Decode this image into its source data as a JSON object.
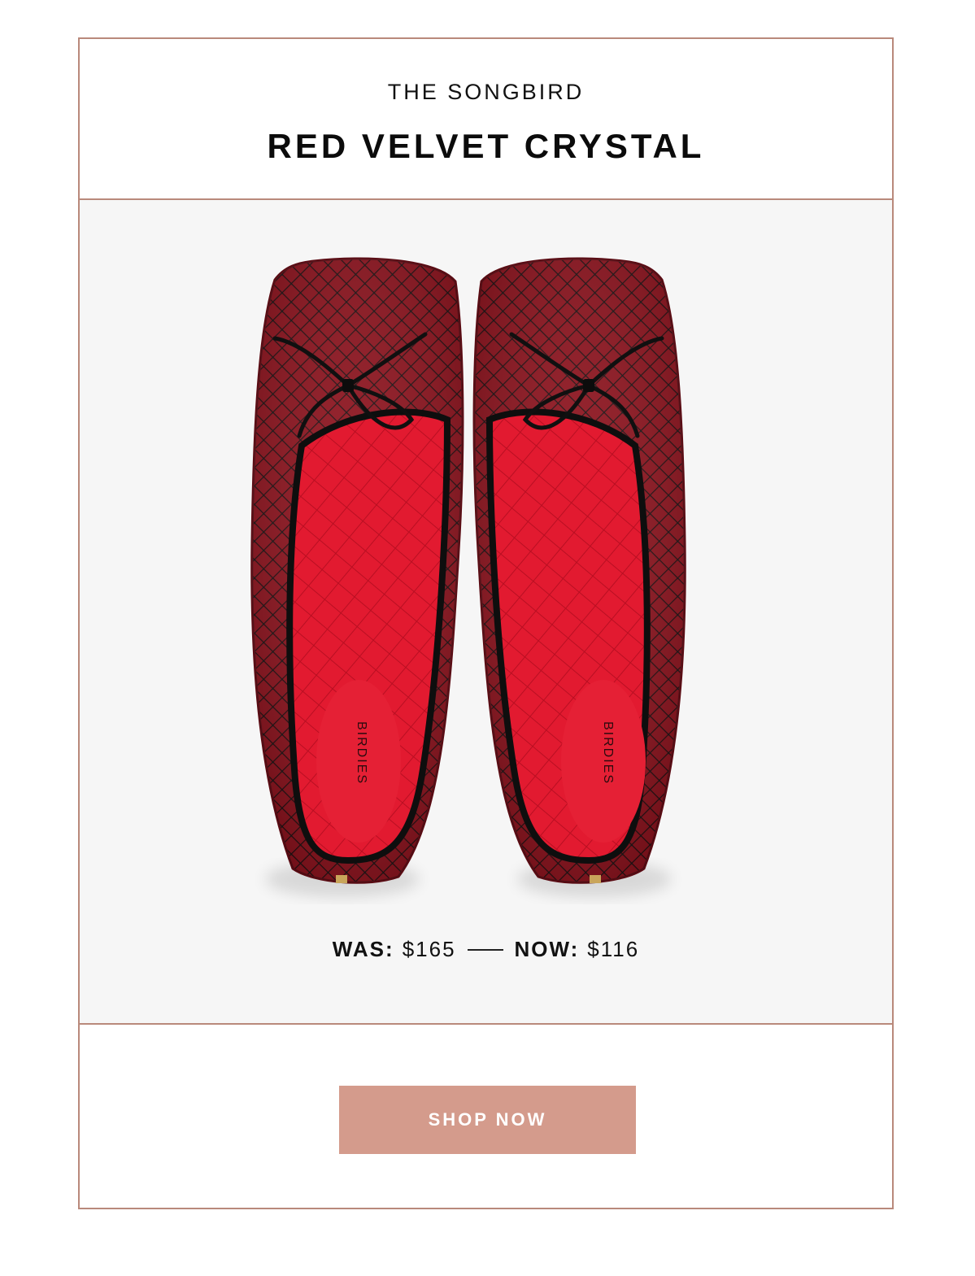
{
  "header": {
    "eyebrow": "THE SONGBIRD",
    "title": "RED VELVET CRYSTAL"
  },
  "product": {
    "image_alt": "Red velvet crystal ballet flats with black bows",
    "insole_brand": "BIRDIES"
  },
  "price": {
    "was_label": "WAS:",
    "was_value": "$165",
    "now_label": "NOW:",
    "now_value": "$116"
  },
  "cta": {
    "label": "SHOP NOW"
  },
  "colors": {
    "border": "#b9897b",
    "cta_background": "#d49b8c",
    "product_background": "#f6f6f6",
    "shoe_velvet": "#8c0f1a",
    "shoe_lining": "#e0182e"
  }
}
